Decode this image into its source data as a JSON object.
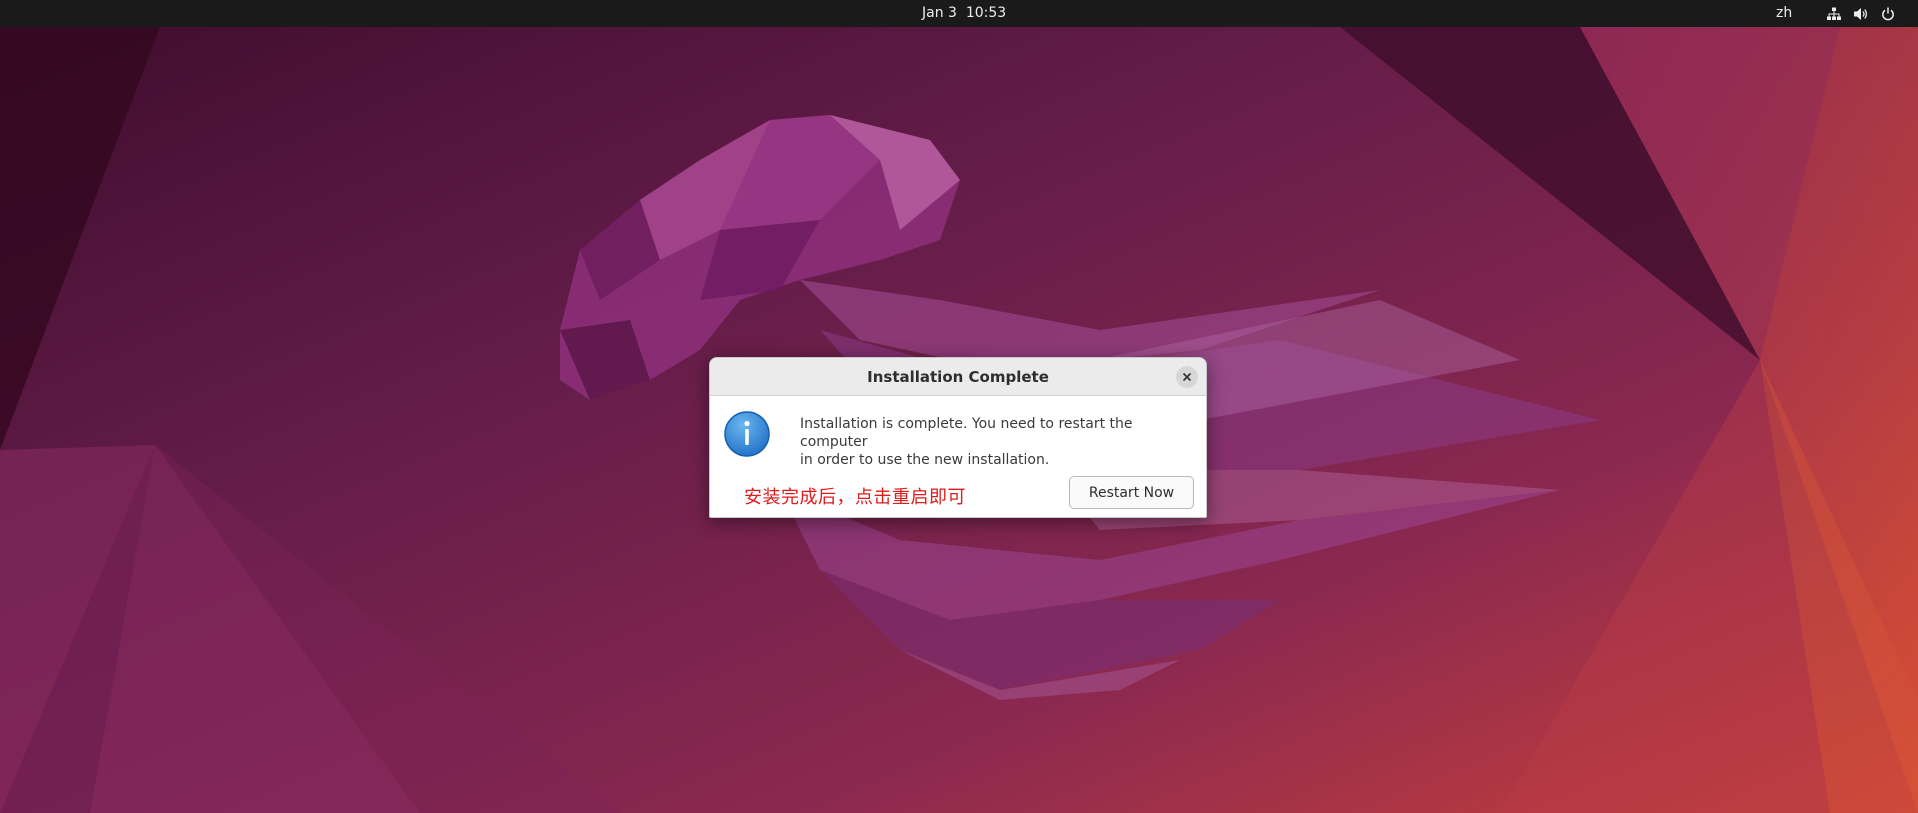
{
  "topbar": {
    "date": "Jan 3",
    "time": "10:53",
    "input_language": "zh",
    "tray_icons": [
      "network-icon",
      "volume-icon",
      "power-icon"
    ]
  },
  "dialog": {
    "title": "Installation Complete",
    "message_line1": "Installation is complete. You need to restart the computer",
    "message_line2": "in order to use the new installation.",
    "annotation": "安装完成后，点击重启即可",
    "restart_label": "Restart Now",
    "icon": "info-icon",
    "close_icon": "close-icon"
  },
  "colors": {
    "annotation": "#e01b1b",
    "info_icon": "#2a7fd4",
    "topbar": "#1a1a1a"
  }
}
